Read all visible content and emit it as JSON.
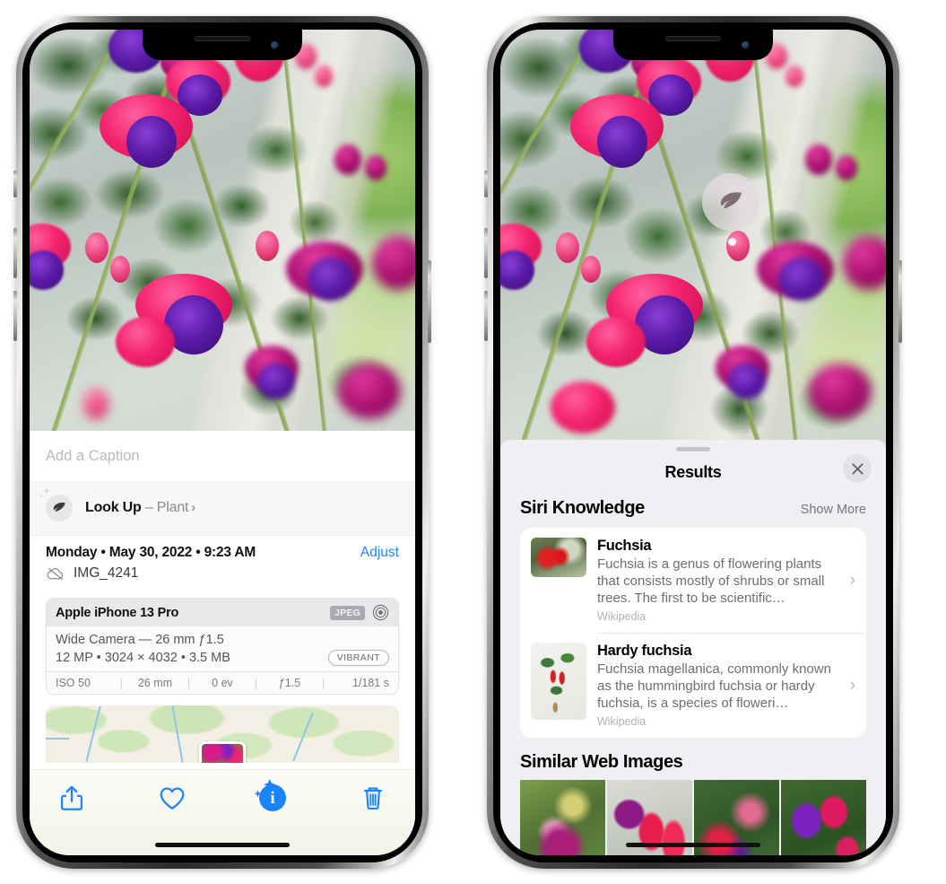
{
  "left_phone": {
    "caption_placeholder": "Add a Caption",
    "look_up": {
      "label": "Look Up",
      "dash": " – ",
      "subject": "Plant",
      "chevron": "›",
      "leaf_icon": "leaf-icon",
      "sparkle_icon": "sparkles-icon"
    },
    "metadata": {
      "date": "Monday • May 30, 2022 • 9:23 AM",
      "adjust_label": "Adjust",
      "filename": "IMG_4241",
      "cloud_icon": "icloud-slash-icon"
    },
    "exif": {
      "model": "Apple iPhone 13 Pro",
      "format_tag": "JPEG",
      "aperture_icon": "aperture-icon",
      "lens_line": "Wide Camera — 26 mm ƒ1.5",
      "size_line": "12 MP • 3024 × 4032 • 3.5 MB",
      "style_tag": "VIBRANT",
      "settings": [
        "ISO 50",
        "26 mm",
        "0 ev",
        "ƒ1.5",
        "1/181 s"
      ],
      "separator": "|"
    },
    "toolbar": {
      "share_label": "share-button",
      "favorite_label": "favorite-button",
      "info_label": "i",
      "delete_label": "delete-button"
    }
  },
  "right_phone": {
    "visual_lookup_badge": {
      "icon": "leaf-icon"
    },
    "results": {
      "title": "Results",
      "close_icon": "close-icon",
      "siri_knowledge": {
        "title": "Siri Knowledge",
        "show_more": "Show More",
        "cards": [
          {
            "title": "Fuchsia",
            "description": "Fuchsia is a genus of flowering plants that consists mostly of shrubs or small trees. The first to be scientific…",
            "source": "Wikipedia",
            "chevron": "›"
          },
          {
            "title": "Hardy fuchsia",
            "description": "Fuchsia magellanica, commonly known as the hummingbird fuchsia or hardy fuchsia, is a species of floweri…",
            "source": "Wikipedia",
            "chevron": "›"
          }
        ]
      },
      "similar_web_images": {
        "title": "Similar Web Images",
        "thumbnails": [
          "web-image-1",
          "web-image-2",
          "web-image-3",
          "web-image-4"
        ]
      }
    }
  },
  "colors": {
    "accent_blue": "#1a84ff",
    "panel_bg": "#f0f0f4",
    "card_bg": "#ffffff",
    "secondary_text": "#6d6d73"
  }
}
